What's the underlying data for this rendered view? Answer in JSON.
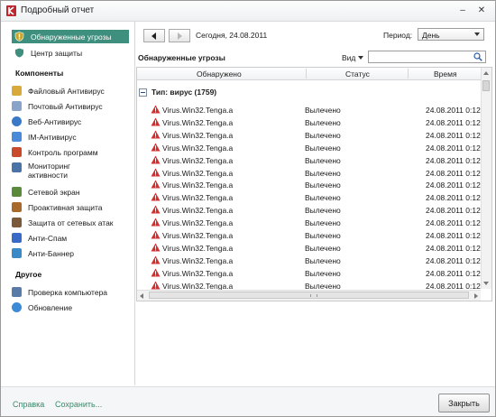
{
  "window": {
    "title": "Подробный отчет"
  },
  "sidebar": {
    "top_items": [
      {
        "label": "Обнаруженные угрозы",
        "icon": "shield-threat-icon",
        "active": true
      },
      {
        "label": "Центр защиты",
        "icon": "shield-icon",
        "active": false
      }
    ],
    "components_heading": "Компоненты",
    "components": [
      {
        "label": "Файловый Антивирус",
        "icon": "folder-icon",
        "color": "#d9a93a"
      },
      {
        "label": "Почтовый Антивирус",
        "icon": "mail-icon",
        "color": "#8aa3c8"
      },
      {
        "label": "Веб-Антивирус",
        "icon": "globe-icon",
        "color": "#3a78c8"
      },
      {
        "label": "IM-Антивирус",
        "icon": "chat-icon",
        "color": "#4a8ad8"
      },
      {
        "label": "Контроль программ",
        "icon": "program-control-icon",
        "color": "#c84a2a"
      },
      {
        "label": "Мониторинг\nактивности",
        "icon": "monitor-icon",
        "color": "#4a74a8"
      },
      {
        "label": "Сетевой экран",
        "icon": "firewall-icon",
        "color": "#5a8a3a"
      },
      {
        "label": "Проактивная защита",
        "icon": "proactive-icon",
        "color": "#a86a2a"
      },
      {
        "label": "Защита от сетевых атак",
        "icon": "network-attack-icon",
        "color": "#7a5a3a"
      },
      {
        "label": "Анти-Спам",
        "icon": "antispam-icon",
        "color": "#3a6ac8"
      },
      {
        "label": "Анти-Баннер",
        "icon": "antibanner-icon",
        "color": "#3a8ac8"
      }
    ],
    "other_heading": "Другое",
    "other": [
      {
        "label": "Проверка компьютера",
        "icon": "scan-icon",
        "color": "#5a7aa8"
      },
      {
        "label": "Обновление",
        "icon": "update-icon",
        "color": "#3a8ad8"
      }
    ]
  },
  "toolbar": {
    "date_text": "Сегодня, 24.08.2011",
    "period_label": "Период:",
    "period_value": "День"
  },
  "panel": {
    "title": "Обнаруженные угрозы",
    "view_label": "Вид",
    "search_value": ""
  },
  "grid": {
    "columns": [
      "Обнаружено",
      "Статус",
      "Время"
    ],
    "group_label": "Тип: вирус (1759)",
    "rows": [
      {
        "name": "Virus.Win32.Tenga.a",
        "status": "Вылечено",
        "time": "24.08.2011 0:12"
      },
      {
        "name": "Virus.Win32.Tenga.a",
        "status": "Вылечено",
        "time": "24.08.2011 0:12"
      },
      {
        "name": "Virus.Win32.Tenga.a",
        "status": "Вылечено",
        "time": "24.08.2011 0:12"
      },
      {
        "name": "Virus.Win32.Tenga.a",
        "status": "Вылечено",
        "time": "24.08.2011 0:12"
      },
      {
        "name": "Virus.Win32.Tenga.a",
        "status": "Вылечено",
        "time": "24.08.2011 0:12"
      },
      {
        "name": "Virus.Win32.Tenga.a",
        "status": "Вылечено",
        "time": "24.08.2011 0:12"
      },
      {
        "name": "Virus.Win32.Tenga.a",
        "status": "Вылечено",
        "time": "24.08.2011 0:12"
      },
      {
        "name": "Virus.Win32.Tenga.a",
        "status": "Вылечено",
        "time": "24.08.2011 0:12"
      },
      {
        "name": "Virus.Win32.Tenga.a",
        "status": "Вылечено",
        "time": "24.08.2011 0:12"
      },
      {
        "name": "Virus.Win32.Tenga.a",
        "status": "Вылечено",
        "time": "24.08.2011 0:12"
      },
      {
        "name": "Virus.Win32.Tenga.a",
        "status": "Вылечено",
        "time": "24.08.2011 0:12"
      },
      {
        "name": "Virus.Win32.Tenga.a",
        "status": "Вылечено",
        "time": "24.08.2011 0:12"
      },
      {
        "name": "Virus.Win32.Tenga.a",
        "status": "Вылечено",
        "time": "24.08.2011 0:12"
      },
      {
        "name": "Virus.Win32.Tenga.a",
        "status": "Вылечено",
        "time": "24.08.2011 0:12"
      },
      {
        "name": "Virus.Win32.Tenga.a",
        "status": "Вылечено",
        "time": "24.08.2011 0:12"
      }
    ]
  },
  "footer": {
    "help_label": "Справка",
    "save_label": "Сохранить...",
    "close_label": "Закрыть"
  },
  "colors": {
    "accent": "#3f8f7e",
    "link": "#3a8a6a",
    "warning": "#d32f2f"
  }
}
